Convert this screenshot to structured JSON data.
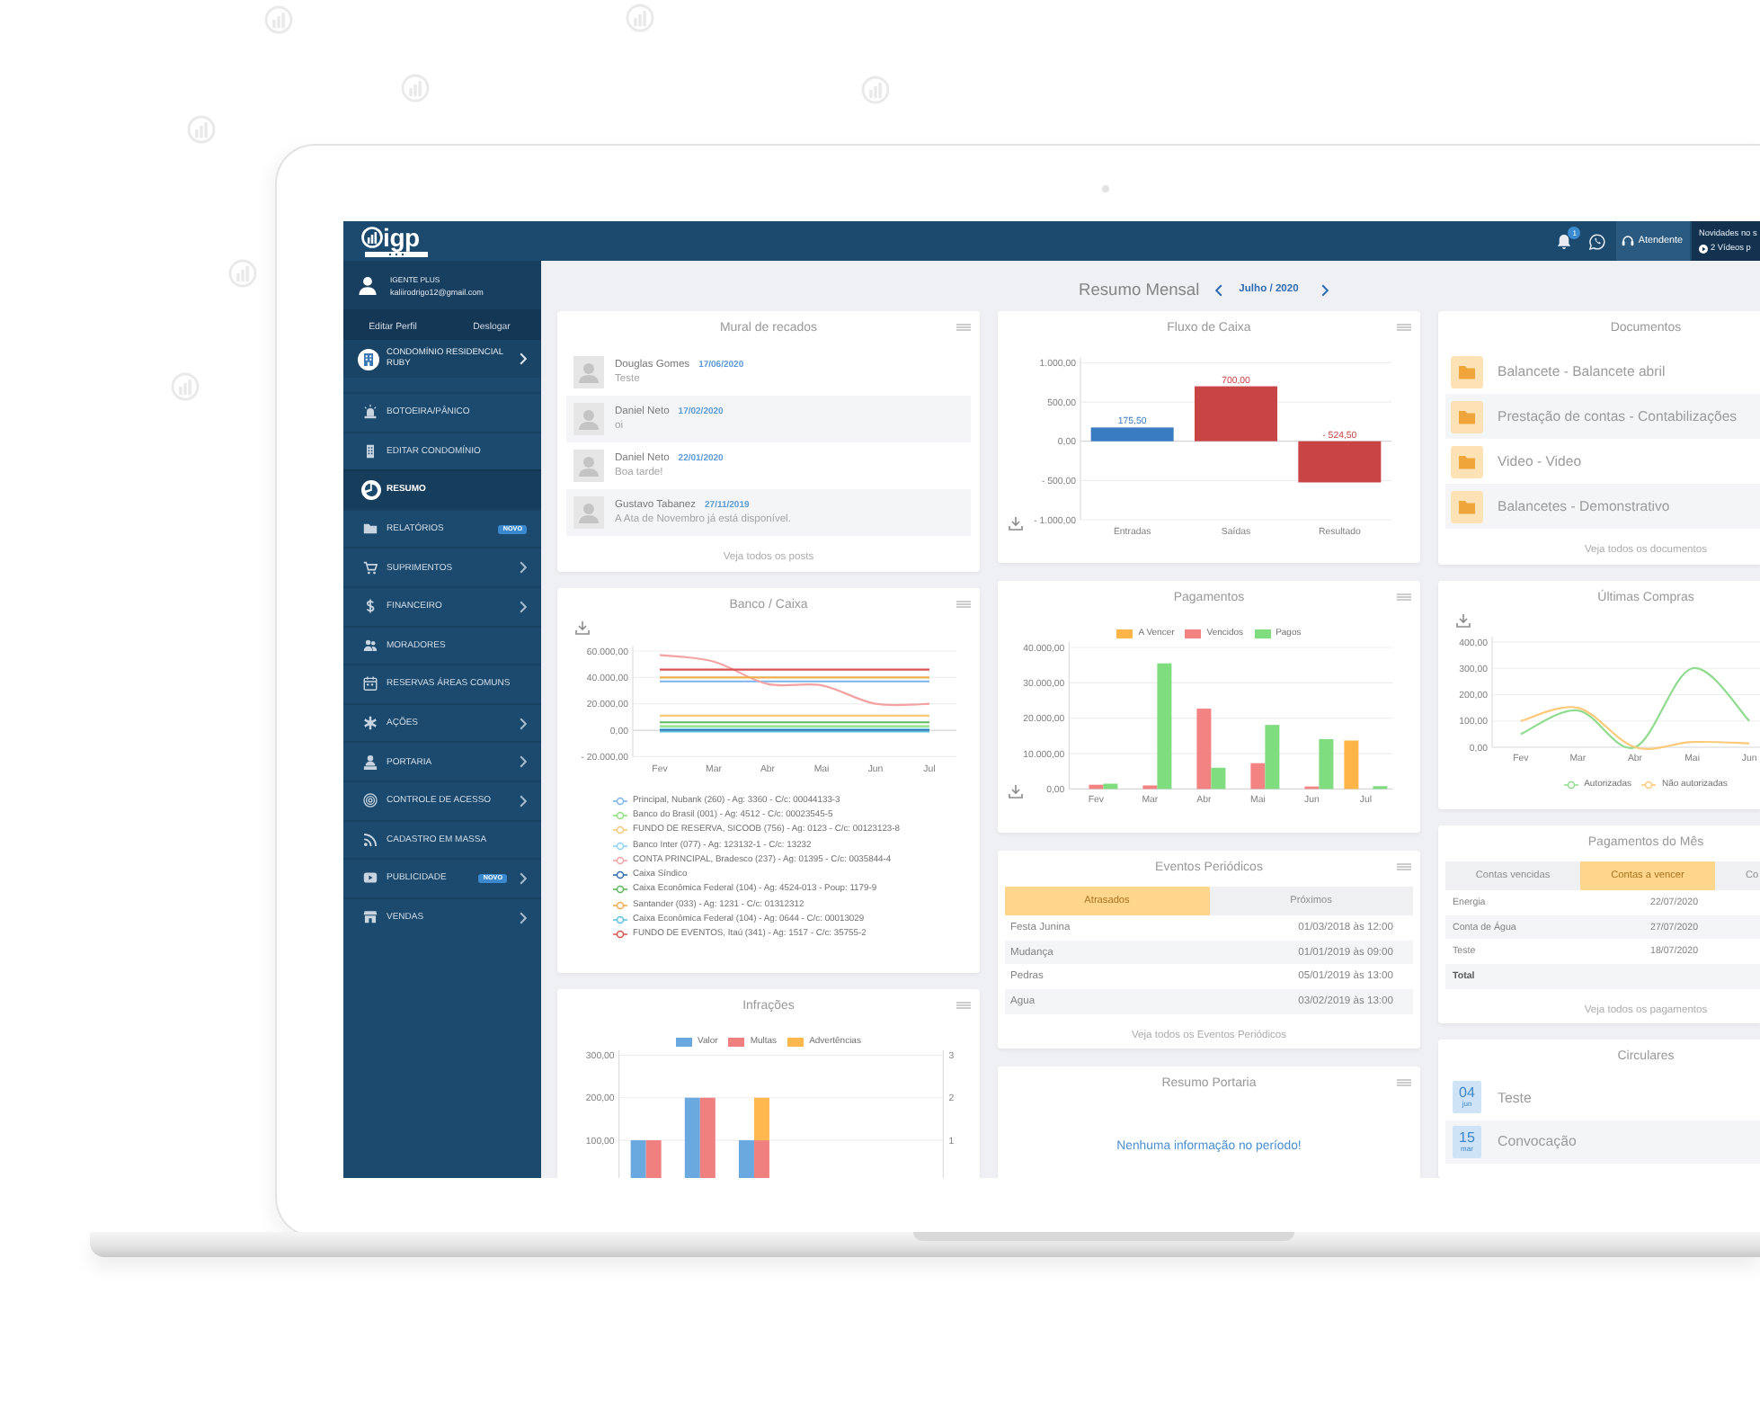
{
  "topbar": {
    "logo_text": "igp",
    "notifications": "1",
    "attendant": "Atendente",
    "news_title": "Novidades no s",
    "news_videos": "2 Vídeos p"
  },
  "sidebar": {
    "user_name": "IGENTE PLUS",
    "user_email": "kaliirodrigo12@gmail.com",
    "links": [
      "Editar Perfil",
      "Deslogar"
    ],
    "condo": "CONDOMÍNIO RESIDENCIAL RUBY",
    "items": [
      {
        "label": "BOTOEIRA/PÂNICO",
        "selected": false,
        "submenu": false
      },
      {
        "label": "EDITAR CONDOMÍNIO",
        "selected": false,
        "submenu": false
      },
      {
        "label": "RESUMO",
        "selected": true,
        "submenu": false
      },
      {
        "label": "RELATÓRIOS",
        "selected": false,
        "submenu": false,
        "badge": "NOVO"
      },
      {
        "label": "SUPRIMENTOS",
        "selected": false,
        "submenu": true
      },
      {
        "label": "FINANCEIRO",
        "selected": false,
        "submenu": true
      },
      {
        "label": "MORADORES",
        "selected": false,
        "submenu": false
      },
      {
        "label": "RESERVAS ÁREAS COMUNS",
        "selected": false,
        "submenu": false
      },
      {
        "label": "AÇÕES",
        "selected": false,
        "submenu": true
      },
      {
        "label": "PORTARIA",
        "selected": false,
        "submenu": true
      },
      {
        "label": "CONTROLE DE ACESSO",
        "selected": false,
        "submenu": true
      },
      {
        "label": "CADASTRO EM MASSA",
        "selected": false,
        "submenu": false
      },
      {
        "label": "PUBLICIDADE",
        "selected": false,
        "submenu": true,
        "badge": "NOVO"
      },
      {
        "label": "VENDAS",
        "selected": false,
        "submenu": true
      }
    ]
  },
  "summary": {
    "title": "Resumo Mensal",
    "period": "Julho / 2020"
  },
  "columns": [
    [
      {
        "kind": "posts",
        "title": "Mural de recados",
        "menu": true,
        "posts": [
          {
            "author": "Douglas Gomes",
            "date": "17/06/2020",
            "text": "Teste"
          },
          {
            "author": "Daniel Neto",
            "date": "17/02/2020",
            "text": "oi"
          },
          {
            "author": "Daniel Neto",
            "date": "22/01/2020",
            "text": "Boa tarde!"
          },
          {
            "author": "Gustavo Tabanez",
            "date": "27/11/2019",
            "text": "A Ata de Novembro já está disponível."
          }
        ],
        "link": "Veja todos os posts"
      },
      {
        "kind": "chart",
        "title": "Banco / Caixa",
        "menu": true,
        "download": true,
        "chart_data": {
          "type": "line",
          "categories": [
            "Fev",
            "Mar",
            "Abr",
            "Mai",
            "Jun",
            "Jul"
          ],
          "ylim": [
            -20000,
            60000
          ],
          "yticks": [
            {
              "value": -20000,
              "label": "- 20.000,00"
            },
            {
              "value": 0,
              "label": "0,00"
            },
            {
              "value": 20000,
              "label": "20.000,00"
            },
            {
              "value": 40000,
              "label": "40.000,00"
            },
            {
              "value": 60000,
              "label": "60.000,00"
            }
          ],
          "grid": true,
          "legend": "bottom",
          "series": [
            {
              "name": "Principal, Nubank (260) - Ag: 3360 - C/c: 00044133-3",
              "color": "#7cb5ec",
              "values": [
                37000,
                37000,
                37000,
                37000,
                37000,
                37000
              ]
            },
            {
              "name": "Banco do Brasil (001) - Ag: 4512 - C/c: 00023545-5",
              "color": "#90e07d",
              "values": [
                3000,
                3000,
                3000,
                3000,
                3000,
                3000
              ]
            },
            {
              "name": "FUNDO DE RESERVA, SICOOB (756) - Ag: 0123 - C/c: 00123123-8",
              "color": "#f7c77a",
              "values": [
                11000,
                11000,
                11000,
                11000,
                11000,
                11000
              ]
            },
            {
              "name": "Banco Inter (077) - Ag: 123132-1 - C/c: 13232",
              "color": "#8fd3f5",
              "values": [
                1000,
                1000,
                1000,
                1000,
                1000,
                1000
              ]
            },
            {
              "name": "CONTA PRINCIPAL, Bradesco (237) - Ag: 01395 - C/c: 0035844-4",
              "color": "#f4a3a3",
              "values": [
                57000,
                52000,
                35000,
                34000,
                20000,
                20000
              ]
            },
            {
              "name": "Caixa Síndico",
              "color": "#2f6fb0",
              "values": [
                0,
                0,
                0,
                0,
                0,
                0
              ]
            },
            {
              "name": "Caixa Econômica Federal (104) - Ag: 4524-013 - Poup: 1179-9",
              "color": "#5cb85c",
              "values": [
                6000,
                6000,
                6000,
                6000,
                6000,
                6000
              ]
            },
            {
              "name": "Santander (033) - Ag: 1231 - C/c: 01312312",
              "color": "#f0ad4e",
              "values": [
                40000,
                40000,
                40000,
                40000,
                40000,
                40000
              ]
            },
            {
              "name": "Caixa Econômica Federal (104) - Ag: 0644 - C/c: 00013029",
              "color": "#5bc0de",
              "values": [
                -1000,
                -1000,
                -1000,
                -1000,
                -1000,
                -1000
              ]
            },
            {
              "name": "FUNDO DE EVENTOS, Itaú (341) - Ag: 1517 - C/c: 35755-2",
              "color": "#d9534f",
              "values": [
                46000,
                46000,
                46000,
                46000,
                46000,
                46000
              ]
            }
          ]
        }
      },
      {
        "kind": "chart",
        "title": "Infrações",
        "menu": true,
        "download": false,
        "chart_data": {
          "type": "bar",
          "ylim": [
            0,
            300
          ],
          "yticks": [
            {
              "value": 100,
              "label": "100,00"
            },
            {
              "value": 200,
              "label": "200,00"
            },
            {
              "value": 300,
              "label": "300,00"
            }
          ],
          "y2lim": [
            0,
            3
          ],
          "y2ticks": [
            1,
            2,
            3
          ],
          "grid": true,
          "legend": "top",
          "stacked": true,
          "series": [
            {
              "name": "Valor",
              "color": "#6aa8e0",
              "values": [
                100,
                200,
                100,
                null,
                null,
                null
              ]
            },
            {
              "name": "Multas",
              "color": "#f08080",
              "values": [
                1,
                2,
                1,
                null,
                null,
                null
              ],
              "axis": "y2"
            },
            {
              "name": "Advertências",
              "color": "#ffb84d",
              "values": [
                0,
                0,
                1,
                null,
                null,
                null
              ],
              "axis": "y2"
            }
          ]
        }
      }
    ],
    [
      {
        "kind": "chart",
        "title": "Fluxo de Caixa",
        "menu": true,
        "download": true,
        "chart_data": {
          "type": "bar",
          "categories": [
            "Entradas",
            "Saídas",
            "Resultado"
          ],
          "ylim": [
            -1000,
            1000
          ],
          "yticks": [
            {
              "value": -1000,
              "label": "- 1.000,00"
            },
            {
              "value": -500,
              "label": "- 500,00"
            },
            {
              "value": 0,
              "label": "0,00"
            },
            {
              "value": 500,
              "label": "500,00"
            },
            {
              "value": 1000,
              "label": "1.000,00"
            }
          ],
          "grid": true,
          "stacked": true,
          "series": [
            {
              "color": "#3a7cc1",
              "values": [
                175.5,
                null,
                null
              ]
            },
            {
              "color": "#c94545",
              "values": [
                null,
                700,
                -524.5
              ]
            }
          ],
          "value_labels": [
            "175,50",
            "700,00",
            "- 524,50"
          ]
        }
      },
      {
        "kind": "chart",
        "title": "Pagamentos",
        "menu": true,
        "download": true,
        "chart_data": {
          "type": "bar",
          "categories": [
            "Fev",
            "Mar",
            "Abr",
            "Mai",
            "Jun",
            "Jul"
          ],
          "ylim": [
            0,
            40000
          ],
          "yticks": [
            {
              "value": 0,
              "label": "0,00"
            },
            {
              "value": 10000,
              "label": "10.000,00"
            },
            {
              "value": 20000,
              "label": "20.000,00"
            },
            {
              "value": 30000,
              "label": "30.000,00"
            },
            {
              "value": 40000,
              "label": "40.000,00"
            }
          ],
          "grid": true,
          "legend": "top",
          "series": [
            {
              "name": "A Vencer",
              "color": "#ffb547",
              "values": [
                0,
                0,
                0,
                0,
                0,
                13700
              ]
            },
            {
              "name": "Vencidos",
              "color": "#f38383",
              "values": [
                1200,
                1000,
                22700,
                7300,
                700,
                0
              ]
            },
            {
              "name": "Pagos",
              "color": "#7fdc7f",
              "values": [
                1500,
                35500,
                6000,
                18100,
                14100,
                800
              ]
            }
          ]
        }
      },
      {
        "kind": "tabs_table",
        "title": "Eventos Periódicos",
        "menu": true,
        "tabs": [
          {
            "label": "Atrasados",
            "selected": true
          },
          {
            "label": "Próximos",
            "selected": false
          }
        ],
        "rows": [
          {
            "name": "Festa Junina",
            "date": "01/03/2018 às 12:00"
          },
          {
            "name": "Mudança",
            "date": "01/01/2019 às 09:00"
          },
          {
            "name": "Pedras",
            "date": "05/01/2019 às 13:00"
          },
          {
            "name": "Agua",
            "date": "03/02/2019 às 13:00"
          }
        ],
        "link": "Veja todos os Eventos Periódicos"
      },
      {
        "kind": "message",
        "title": "Resumo Portaria",
        "menu": true,
        "message": "Nenhuma informação no período!"
      }
    ],
    [
      {
        "kind": "documents",
        "title": "Documentos",
        "menu": false,
        "items": [
          "Balancete - Balancete abril",
          "Prestação de contas - Contabilizações",
          "Video - Video",
          "Balancetes - Demonstrativo"
        ],
        "link": "Veja todos os documentos"
      },
      {
        "kind": "chart",
        "title": "Últimas Compras",
        "menu": false,
        "download": true,
        "chart_data": {
          "type": "line",
          "categories": [
            "Fev",
            "Mar",
            "Abr",
            "Mai",
            "Jun"
          ],
          "ylim": [
            0,
            400
          ],
          "yticks": [
            {
              "value": 0,
              "label": "0,00"
            },
            {
              "value": 100,
              "label": "100,00"
            },
            {
              "value": 200,
              "label": "200,00"
            },
            {
              "value": 300,
              "label": "300,00"
            },
            {
              "value": 400,
              "label": "400,00"
            }
          ],
          "grid": true,
          "legend": "bottom",
          "series": [
            {
              "name": "Autorizadas",
              "color": "#8fdc8f",
              "values": [
                50,
                140,
                0,
                300,
                100
              ]
            },
            {
              "name": "Não autorizadas",
              "color": "#ffc97a",
              "values": [
                100,
                150,
                0,
                20,
                15
              ]
            }
          ]
        }
      },
      {
        "kind": "tabs_table",
        "title": "Pagamentos do Mês",
        "menu": false,
        "tabs": [
          {
            "label": "Contas vencidas",
            "selected": false
          },
          {
            "label": "Contas a vencer",
            "selected": true
          },
          {
            "label": "Co",
            "selected": false
          }
        ],
        "rows": [
          {
            "name": "Energia",
            "date": "22/07/2020"
          },
          {
            "name": "Conta de Água",
            "date": "27/07/2020"
          },
          {
            "name": "Teste",
            "date": "18/07/2020"
          }
        ],
        "total_label": "Total",
        "link": "Veja todos os pagamentos"
      },
      {
        "kind": "circulars",
        "title": "Circulares",
        "menu": false,
        "items": [
          {
            "day": "04",
            "month": "jun",
            "title": "Teste"
          },
          {
            "day": "15",
            "month": "mar",
            "title": "Convocação"
          }
        ]
      }
    ]
  ]
}
